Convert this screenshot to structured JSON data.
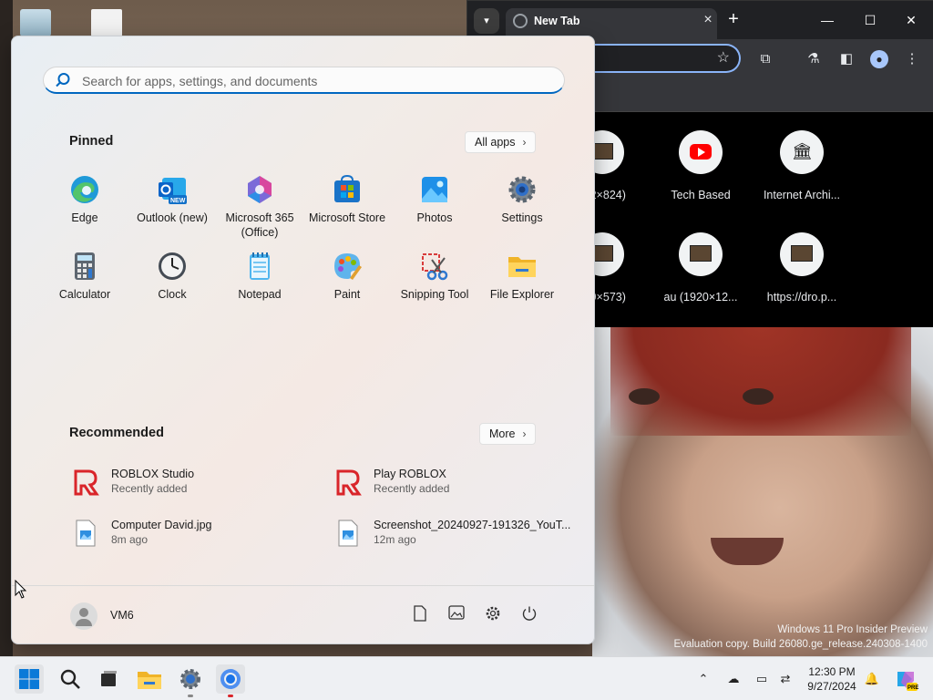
{
  "chrome": {
    "tab_title": "New Tab",
    "shortcuts": [
      {
        "label": "…2×824)"
      },
      {
        "label": "Tech Based"
      },
      {
        "label": "Internet Archi..."
      },
      {
        "label": "…9×573)"
      },
      {
        "label": "au (1920×12..."
      },
      {
        "label": "https://dro.p..."
      }
    ]
  },
  "start_menu": {
    "search_placeholder": "Search for apps, settings, and documents",
    "pinned_title": "Pinned",
    "all_apps_label": "All apps",
    "pinned": [
      {
        "name": "Edge",
        "icon": "edge-icon"
      },
      {
        "name": "Outlook (new)",
        "icon": "outlook-icon"
      },
      {
        "name": "Microsoft 365 (Office)",
        "icon": "microsoft-365-icon"
      },
      {
        "name": "Microsoft Store",
        "icon": "microsoft-store-icon"
      },
      {
        "name": "Photos",
        "icon": "photos-icon"
      },
      {
        "name": "Settings",
        "icon": "settings-icon"
      },
      {
        "name": "Calculator",
        "icon": "calculator-icon"
      },
      {
        "name": "Clock",
        "icon": "clock-icon"
      },
      {
        "name": "Notepad",
        "icon": "notepad-icon"
      },
      {
        "name": "Paint",
        "icon": "paint-icon"
      },
      {
        "name": "Snipping Tool",
        "icon": "snipping-tool-icon"
      },
      {
        "name": "File Explorer",
        "icon": "file-explorer-icon"
      }
    ],
    "recommended_title": "Recommended",
    "more_label": "More",
    "recommended": [
      {
        "title": "ROBLOX Studio",
        "subtitle": "Recently added"
      },
      {
        "title": "Play ROBLOX",
        "subtitle": "Recently added"
      },
      {
        "title": "Computer David.jpg",
        "subtitle": "8m ago"
      },
      {
        "title": "Screenshot_20240927-191326_YouT...",
        "subtitle": "12m ago"
      }
    ],
    "user_name": "VM6"
  },
  "desktop": {
    "watermark_line1": "Windows 11 Pro Insider Preview",
    "watermark_line2": "Evaluation copy. Build 26080.ge_release.240308-1400"
  },
  "taskbar": {
    "time": "12:30 PM",
    "date": "9/27/2024"
  },
  "colors": {
    "accent": "#0067c0",
    "chrome_dark": "#202124",
    "youtube_red": "#ff0000"
  }
}
